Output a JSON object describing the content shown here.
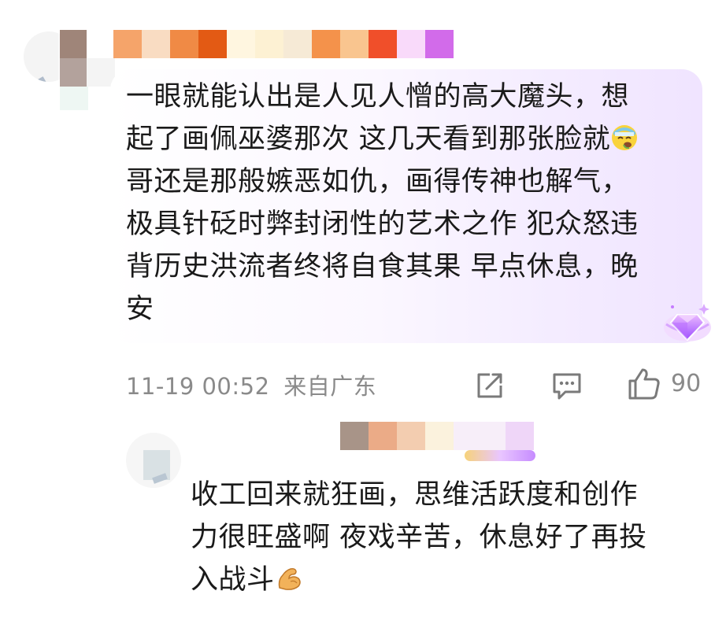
{
  "comment": {
    "text_lines": [
      "一眼就能认出是人见人憎的高大魔头，想",
      "起了画佩巫婆那次 这几天看到那张脸就",
      "哥还是那般嫉恶如仇，画得传神也解气，",
      "极具针砭时弊封闭性的艺术之作 犯众怒违",
      "背历史洪流者终将自食其果 早点休息，晚",
      "安"
    ],
    "inline_emoji": "nauseated-face-icon",
    "timestamp": "11-19 00:52",
    "location": "来自广东",
    "like_count": "90"
  },
  "reply": {
    "text_lines": [
      "收工回来就狂画，思维活跃度和创作",
      "力很旺盛啊 夜戏辛苦，休息好了再投",
      "入战斗"
    ],
    "inline_emoji": "flexed-biceps-icon"
  },
  "colors": {
    "mosaic_1": [
      "#9e8478",
      "#ffffff",
      "#f5a46a",
      "#f9d7b8",
      "#f08a45",
      "#e35a14",
      "#fff3d8",
      "#fdf3d5",
      "#f8ebd0",
      "#f4924b",
      "#f9c08a",
      "#f04f2a",
      "#f9dafa",
      "#d26bea"
    ],
    "mosaic_2": [
      "#a89488",
      "#e8a07a",
      "#f2c6a5",
      "#fbf0d8",
      "#f6ecf8",
      "#efd0f8"
    ],
    "bubble_gradient_end": "#f0e4ff",
    "meta_text": "#8a8a8a",
    "gem": "#c57bff"
  }
}
